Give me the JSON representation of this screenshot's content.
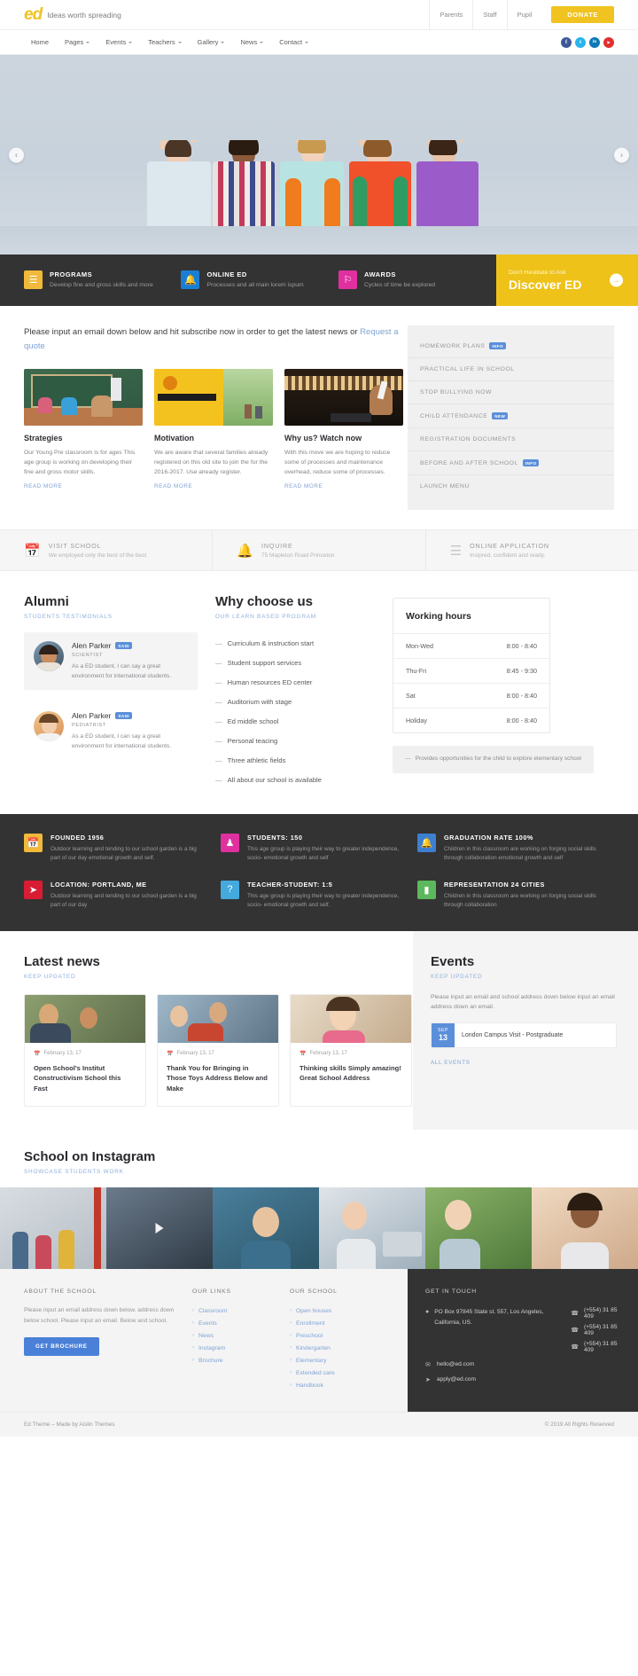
{
  "brand": {
    "logo": "ed",
    "tagline": "Ideas worth spreading",
    "accent": "#f0c320"
  },
  "topnav": {
    "items": [
      "Parents",
      "Staff",
      "Pupil"
    ],
    "donate": "DONATE"
  },
  "mainnav": {
    "items": [
      {
        "label": "Home",
        "caret": false
      },
      {
        "label": "Pages",
        "caret": true
      },
      {
        "label": "Events",
        "caret": true
      },
      {
        "label": "Teachers",
        "caret": true
      },
      {
        "label": "Gallery",
        "caret": true
      },
      {
        "label": "News",
        "caret": true
      },
      {
        "label": "Contact",
        "caret": true
      }
    ],
    "socials": [
      {
        "name": "facebook-icon",
        "glyph": "f",
        "color": "#3b5998"
      },
      {
        "name": "twitter-icon",
        "glyph": "t",
        "color": "#29b3ef"
      },
      {
        "name": "linkedin-icon",
        "glyph": "in",
        "color": "#0d77b7"
      },
      {
        "name": "youtube-icon",
        "glyph": "▶",
        "color": "#e02f2f"
      }
    ]
  },
  "hero": {
    "prev": "‹",
    "next": "›"
  },
  "features": [
    {
      "title": "PROGRAMS",
      "desc": "Develop fine and gross skills and more",
      "icon": "book-icon",
      "glyph": "☰",
      "color": "#f0b93a"
    },
    {
      "title": "ONLINE ED",
      "desc": "Processes and all main lorem ispum",
      "icon": "bell-icon",
      "glyph": "␇",
      "color": "#1a7fd4"
    },
    {
      "title": "AWARDS",
      "desc": "Cycles of time be explored",
      "icon": "award-icon",
      "glyph": "♀",
      "color": "#e0309f"
    }
  ],
  "discover": {
    "sub": "Don't Hestitate to Ask",
    "title": "Discover ED",
    "arrow": "→"
  },
  "intro": {
    "text": "Please input an email down below and hit subscribe now in order to get the latest news or ",
    "link": "Request a quote"
  },
  "cards": [
    {
      "title": "Strategies",
      "desc": "Our Young Pre classroom is for ages This age group is working on developing their fine and gross motor skills.",
      "more": "READ MORE"
    },
    {
      "title": "Motivation",
      "desc": "We are aware that several families already registered on this old site to join the for the 2016-2017. Use already register.",
      "more": "READ MORE"
    },
    {
      "title": "Why us? Watch now",
      "desc": "With this move we are hoping to reduce some of processes and maintenance overhead, reduce some of processes.",
      "more": "READ MORE"
    }
  ],
  "sidemenu": [
    {
      "label": "HOMEWORK PLANS",
      "badge": "INFO"
    },
    {
      "label": "PRACTICAL LIFE IN SCHOOL",
      "badge": ""
    },
    {
      "label": "STOP BULLYING NOW",
      "badge": ""
    },
    {
      "label": "CHILD ATTENDANCE",
      "badge": "NEW"
    },
    {
      "label": "REGISTRATION DOCUMENTS",
      "badge": ""
    },
    {
      "label": "BEFORE AND AFTER SCHOOL",
      "badge": "INFO"
    },
    {
      "label": "LAUNCH MENU",
      "badge": ""
    }
  ],
  "band": [
    {
      "title": "VISIT SCHOOL",
      "desc": "We employed only the best of the best",
      "icon": "calendar-icon",
      "glyph": "Ὄ5"
    },
    {
      "title": "INQUIRE",
      "desc": "75 Mapleton Road Princeton",
      "icon": "bell-icon",
      "glyph": "␇"
    },
    {
      "title": "ONLINE APPLICATION",
      "desc": "Insipred, confident and ready.",
      "icon": "checklist-icon",
      "glyph": "☰"
    }
  ],
  "alumni": {
    "title": "Alumni",
    "subtitle": "STUDENTS TESTIMONIALS",
    "items": [
      {
        "name": "Alen Parker",
        "badge": "SAID",
        "role": "SCIENTIST",
        "text": "As a ED student, I can say a great environment for international students."
      },
      {
        "name": "Alen Parker",
        "badge": "SAID",
        "role": "PEDIATRIST",
        "text": "As a ED student, I can say a great environment for international students."
      }
    ]
  },
  "why": {
    "title": "Why choose us",
    "subtitle": "OUR LEARN BASED PROGRAM",
    "items": [
      "Curriculum & instruction start",
      "Student support services",
      "Human resources ED center",
      "Auditorium with stage",
      "Ed middle school",
      "Personal teacing",
      "Three athletic fields",
      "All about our school is available"
    ]
  },
  "hours": {
    "title": "Working hours",
    "rows": [
      {
        "day": "Mon-Wed",
        "time": "8:00 - 8:40"
      },
      {
        "day": "Thu-Fri",
        "time": "8:45 - 9:30"
      },
      {
        "day": "Sat",
        "time": "8:00 - 8:40"
      },
      {
        "day": "Holiday",
        "time": "8:00 - 8:40"
      }
    ],
    "note": "Provides opportunities for the child to explore elementary school"
  },
  "stats": [
    {
      "title": "FOUNDED 1956",
      "desc": "Outdoor learning and tending to our school garden is a big part of our day emotional growth and self.",
      "icon": "calendar-icon",
      "glyph": "Ὄ5",
      "color": "#f0b93a"
    },
    {
      "title": "STUDENTS: 150",
      "desc": "This age group is playing their way to greater independence, socio- emotional growth and self",
      "icon": "students-icon",
      "glyph": "♟",
      "color": "#e0309f"
    },
    {
      "title": "GRADUATION RATE 100%",
      "desc": "Children in this classroom are working on forging social skills through collaboration emotional growth and self",
      "icon": "bell-icon",
      "glyph": "␇",
      "color": "#3d7fd0"
    },
    {
      "title": "LOCATION: PORTLAND, ME",
      "desc": "Outdoor learning and tending to our school garden is a big part of our day",
      "icon": "send-icon",
      "glyph": "➤",
      "color": "#d81d33"
    },
    {
      "title": "TEACHER-STUDENT: 1:5",
      "desc": "This age group is playing their way to greater independence, socio- emotional growth and self.",
      "icon": "question-icon",
      "glyph": "?",
      "color": "#44aade"
    },
    {
      "title": "REPRESENTATION 24 CITIES",
      "desc": "Children in this classroom are working on forging social skills through collaboration",
      "icon": "bookmark-icon",
      "glyph": "▮",
      "color": "#5cb85c"
    }
  ],
  "news": {
    "title": "Latest news",
    "subtitle": "KEEP UPDATED",
    "items": [
      {
        "date": "February 13, 17",
        "title": "Open School's Institut Constructivism School this Fast"
      },
      {
        "date": "February 13, 17",
        "title": "Thank You for Bringing in Those Toys Address Below and Make"
      },
      {
        "date": "February 13, 17",
        "title": "Thinking skills Simply amazing! Great School Address"
      }
    ]
  },
  "events": {
    "title": "Events",
    "subtitle": "KEEP UPDATED",
    "text": "Please input an email and school address down below input an email address down an email.",
    "item": {
      "month": "SEP",
      "day": "13",
      "name": "London Campus Visit - Postgraduate"
    },
    "all": "ALL EVENTS"
  },
  "instagram": {
    "title": "School on Instagram",
    "subtitle": "SHOWCASE STUDENTS WORK"
  },
  "footer": {
    "about": {
      "heading": "ABOUT THE SCHOOL",
      "text": "Please input an email address down below. address down below school. Please input an email. Below and school.",
      "button": "GET BROCHURE"
    },
    "links": {
      "heading": "OUR LINKS",
      "items": [
        "Classroom",
        "Events",
        "News",
        "Instagram",
        "Brochure"
      ]
    },
    "school": {
      "heading": "OUR SCHOOL",
      "items": [
        "Open houses",
        "Enrollment",
        "Preschool",
        "Kindergarten",
        "Elementary",
        "Extended care",
        "Handbook"
      ]
    },
    "contact": {
      "heading": "GET IN TOUCH",
      "address": "PO Box 97845 State st. 557, Los Angeles, California, US.",
      "phones": [
        "(+554) 31 85 409",
        "(+554) 31 85 409",
        "(+554) 31 85 409"
      ],
      "emails": [
        "hello@ed.com",
        "apply@ed.com"
      ]
    },
    "copyright_left": "Ed Theme – Made by Aislin Themes",
    "copyright_right": "© 2019 All Rights Reserved"
  }
}
